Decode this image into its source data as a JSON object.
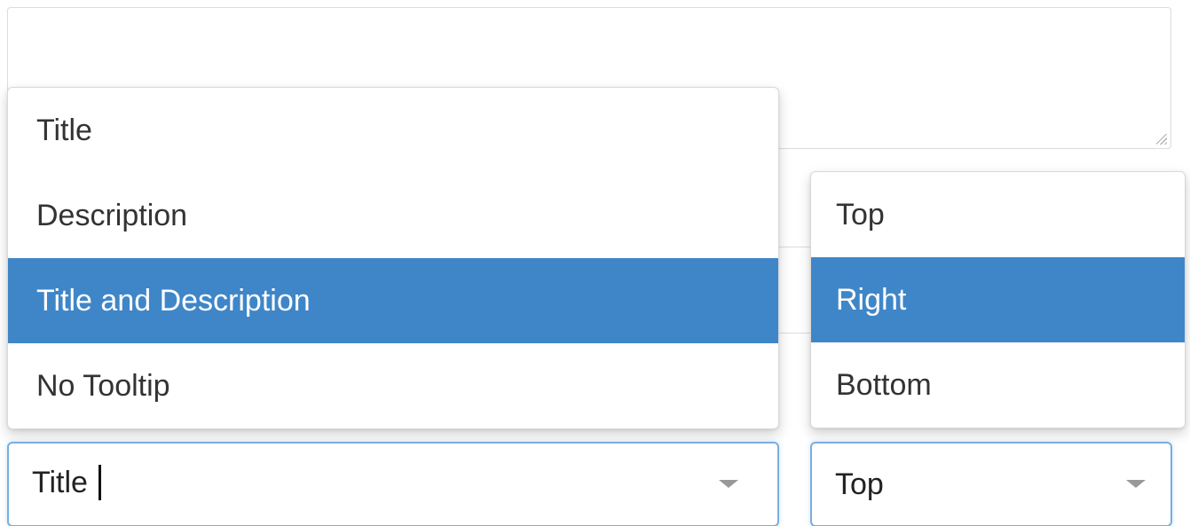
{
  "tooltip_content_select": {
    "options": [
      {
        "label": "Title",
        "selected": false
      },
      {
        "label": "Description",
        "selected": false
      },
      {
        "label": "Title and Description",
        "selected": true
      },
      {
        "label": "No Tooltip",
        "selected": false
      }
    ],
    "current_value": "Title",
    "chevron_icon": "chevron-down-icon"
  },
  "tooltip_position_select": {
    "options": [
      {
        "label": "Top",
        "selected": false
      },
      {
        "label": "Right",
        "selected": true
      },
      {
        "label": "Bottom",
        "selected": false
      }
    ],
    "current_value": "Top",
    "chevron_icon": "chevron-down-icon"
  },
  "colors": {
    "highlight": "#3f86c8",
    "focus_border": "#7aaee0",
    "text": "#333333"
  }
}
